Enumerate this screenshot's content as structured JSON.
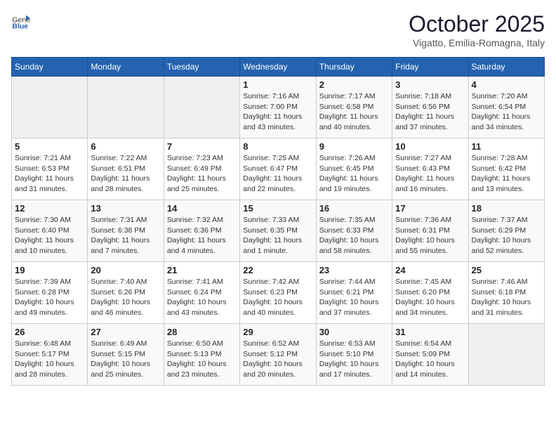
{
  "logo": {
    "general": "General",
    "blue": "Blue"
  },
  "title": "October 2025",
  "subtitle": "Vigatto, Emilia-Romagna, Italy",
  "days_of_week": [
    "Sunday",
    "Monday",
    "Tuesday",
    "Wednesday",
    "Thursday",
    "Friday",
    "Saturday"
  ],
  "weeks": [
    [
      {
        "day": "",
        "info": ""
      },
      {
        "day": "",
        "info": ""
      },
      {
        "day": "",
        "info": ""
      },
      {
        "day": "1",
        "info": "Sunrise: 7:16 AM\nSunset: 7:00 PM\nDaylight: 11 hours and 43 minutes."
      },
      {
        "day": "2",
        "info": "Sunrise: 7:17 AM\nSunset: 6:58 PM\nDaylight: 11 hours and 40 minutes."
      },
      {
        "day": "3",
        "info": "Sunrise: 7:18 AM\nSunset: 6:56 PM\nDaylight: 11 hours and 37 minutes."
      },
      {
        "day": "4",
        "info": "Sunrise: 7:20 AM\nSunset: 6:54 PM\nDaylight: 11 hours and 34 minutes."
      }
    ],
    [
      {
        "day": "5",
        "info": "Sunrise: 7:21 AM\nSunset: 6:53 PM\nDaylight: 11 hours and 31 minutes."
      },
      {
        "day": "6",
        "info": "Sunrise: 7:22 AM\nSunset: 6:51 PM\nDaylight: 11 hours and 28 minutes."
      },
      {
        "day": "7",
        "info": "Sunrise: 7:23 AM\nSunset: 6:49 PM\nDaylight: 11 hours and 25 minutes."
      },
      {
        "day": "8",
        "info": "Sunrise: 7:25 AM\nSunset: 6:47 PM\nDaylight: 11 hours and 22 minutes."
      },
      {
        "day": "9",
        "info": "Sunrise: 7:26 AM\nSunset: 6:45 PM\nDaylight: 11 hours and 19 minutes."
      },
      {
        "day": "10",
        "info": "Sunrise: 7:27 AM\nSunset: 6:43 PM\nDaylight: 11 hours and 16 minutes."
      },
      {
        "day": "11",
        "info": "Sunrise: 7:28 AM\nSunset: 6:42 PM\nDaylight: 11 hours and 13 minutes."
      }
    ],
    [
      {
        "day": "12",
        "info": "Sunrise: 7:30 AM\nSunset: 6:40 PM\nDaylight: 11 hours and 10 minutes."
      },
      {
        "day": "13",
        "info": "Sunrise: 7:31 AM\nSunset: 6:38 PM\nDaylight: 11 hours and 7 minutes."
      },
      {
        "day": "14",
        "info": "Sunrise: 7:32 AM\nSunset: 6:36 PM\nDaylight: 11 hours and 4 minutes."
      },
      {
        "day": "15",
        "info": "Sunrise: 7:33 AM\nSunset: 6:35 PM\nDaylight: 11 hours and 1 minute."
      },
      {
        "day": "16",
        "info": "Sunrise: 7:35 AM\nSunset: 6:33 PM\nDaylight: 10 hours and 58 minutes."
      },
      {
        "day": "17",
        "info": "Sunrise: 7:36 AM\nSunset: 6:31 PM\nDaylight: 10 hours and 55 minutes."
      },
      {
        "day": "18",
        "info": "Sunrise: 7:37 AM\nSunset: 6:29 PM\nDaylight: 10 hours and 52 minutes."
      }
    ],
    [
      {
        "day": "19",
        "info": "Sunrise: 7:39 AM\nSunset: 6:28 PM\nDaylight: 10 hours and 49 minutes."
      },
      {
        "day": "20",
        "info": "Sunrise: 7:40 AM\nSunset: 6:26 PM\nDaylight: 10 hours and 46 minutes."
      },
      {
        "day": "21",
        "info": "Sunrise: 7:41 AM\nSunset: 6:24 PM\nDaylight: 10 hours and 43 minutes."
      },
      {
        "day": "22",
        "info": "Sunrise: 7:42 AM\nSunset: 6:23 PM\nDaylight: 10 hours and 40 minutes."
      },
      {
        "day": "23",
        "info": "Sunrise: 7:44 AM\nSunset: 6:21 PM\nDaylight: 10 hours and 37 minutes."
      },
      {
        "day": "24",
        "info": "Sunrise: 7:45 AM\nSunset: 6:20 PM\nDaylight: 10 hours and 34 minutes."
      },
      {
        "day": "25",
        "info": "Sunrise: 7:46 AM\nSunset: 6:18 PM\nDaylight: 10 hours and 31 minutes."
      }
    ],
    [
      {
        "day": "26",
        "info": "Sunrise: 6:48 AM\nSunset: 5:17 PM\nDaylight: 10 hours and 28 minutes."
      },
      {
        "day": "27",
        "info": "Sunrise: 6:49 AM\nSunset: 5:15 PM\nDaylight: 10 hours and 25 minutes."
      },
      {
        "day": "28",
        "info": "Sunrise: 6:50 AM\nSunset: 5:13 PM\nDaylight: 10 hours and 23 minutes."
      },
      {
        "day": "29",
        "info": "Sunrise: 6:52 AM\nSunset: 5:12 PM\nDaylight: 10 hours and 20 minutes."
      },
      {
        "day": "30",
        "info": "Sunrise: 6:53 AM\nSunset: 5:10 PM\nDaylight: 10 hours and 17 minutes."
      },
      {
        "day": "31",
        "info": "Sunrise: 6:54 AM\nSunset: 5:09 PM\nDaylight: 10 hours and 14 minutes."
      },
      {
        "day": "",
        "info": ""
      }
    ]
  ]
}
